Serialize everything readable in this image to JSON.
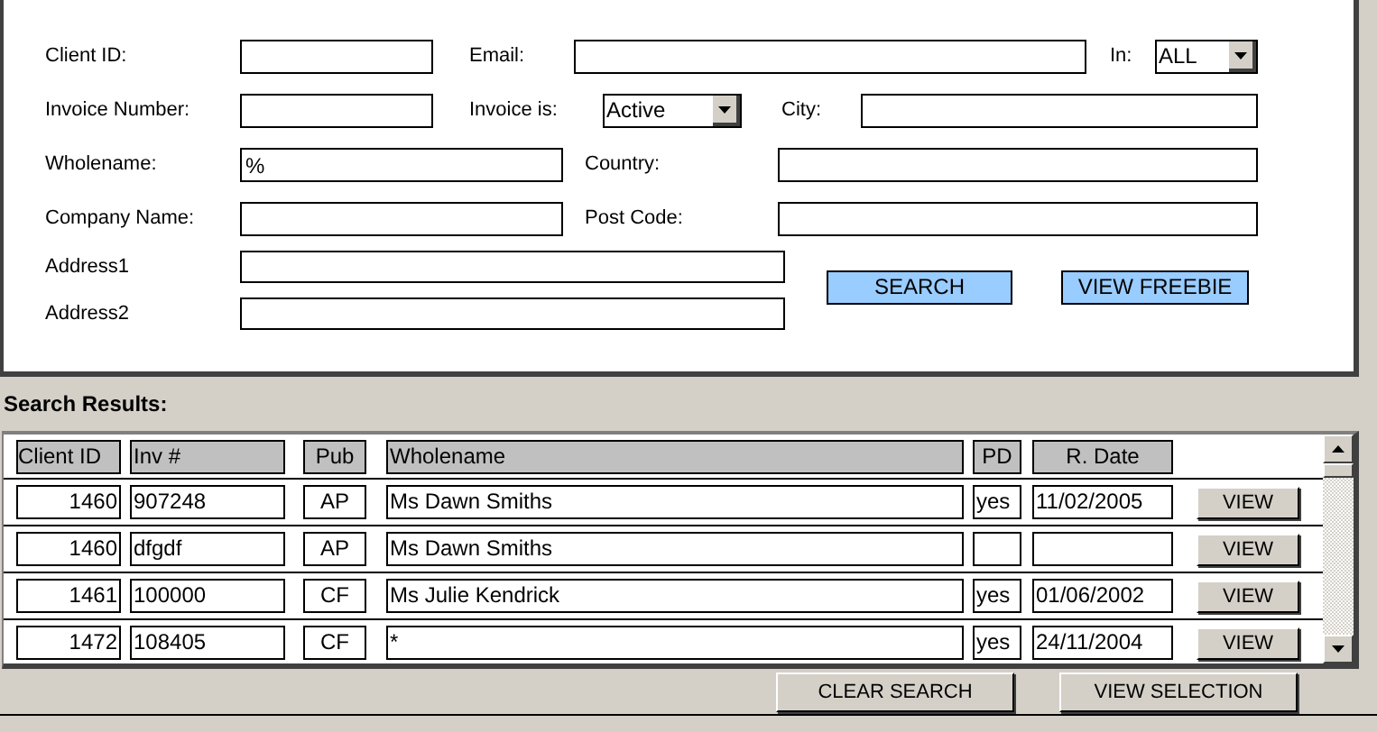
{
  "search_form": {
    "client_id": {
      "label": "Client ID:"
    },
    "email": {
      "label": "Email:"
    },
    "in": {
      "label": "In:",
      "value": "ALL"
    },
    "invoice_number": {
      "label": "Invoice Number:"
    },
    "invoice_is": {
      "label": "Invoice is:",
      "value": "Active"
    },
    "city": {
      "label": "City:"
    },
    "wholename": {
      "label": "Wholename:",
      "value": "%"
    },
    "country": {
      "label": "Country:"
    },
    "company_name": {
      "label": "Company Name:"
    },
    "post_code": {
      "label": "Post Code:"
    },
    "address1": {
      "label": "Address1"
    },
    "address2": {
      "label": "Address2"
    },
    "buttons": [
      "SEARCH",
      "VIEW FREEBIE"
    ]
  },
  "results": {
    "title": "Search Results:",
    "columns": [
      "Client ID",
      "Inv #",
      "Pub",
      "Wholename",
      "PD",
      "R. Date"
    ],
    "rows": [
      {
        "client_id": "1460",
        "inv": "907248",
        "pub": "AP",
        "wholename": "Ms Dawn Smiths",
        "pd": "yes",
        "r_date": "11/02/2005",
        "action": "VIEW"
      },
      {
        "client_id": "1460",
        "inv": "dfgdf",
        "pub": "AP",
        "wholename": "Ms Dawn Smiths",
        "action": "VIEW"
      },
      {
        "client_id": "1461",
        "inv": "100000",
        "pub": "CF",
        "wholename": "Ms Julie Kendrick",
        "pd": "yes",
        "r_date": "01/06/2002",
        "action": "VIEW"
      },
      {
        "client_id": "1472",
        "inv": "108405",
        "pub": "CF",
        "wholename": "*",
        "pd": "yes",
        "r_date": "24/11/2004",
        "action": "VIEW"
      }
    ]
  },
  "bottom_buttons": [
    "CLEAR SEARCH",
    "VIEW SELECTION"
  ]
}
